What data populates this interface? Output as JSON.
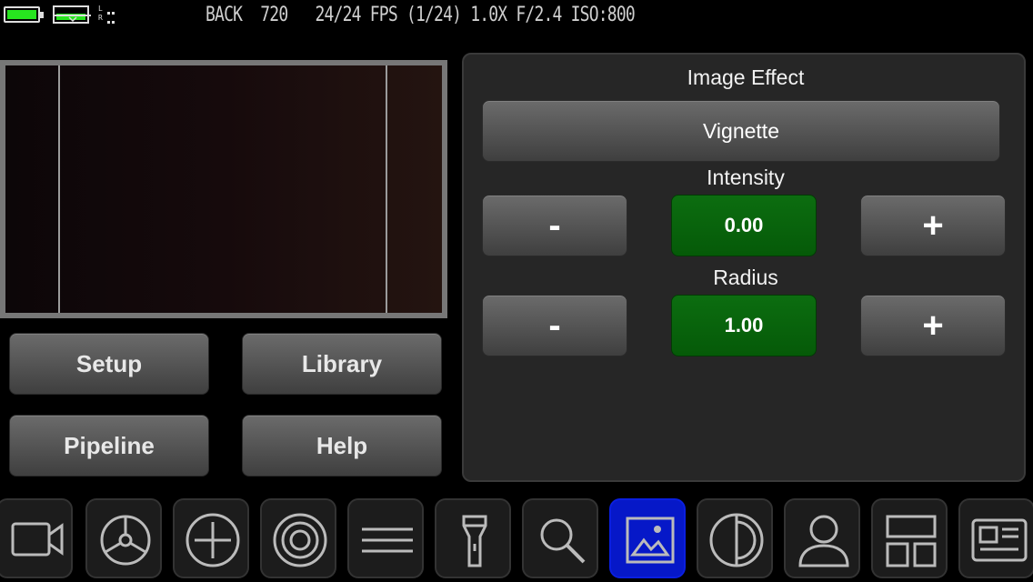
{
  "status": {
    "lr_top": "L",
    "lr_bottom": "R",
    "text": "BACK  720   24/24 FPS (1/24) 1.0X F/2.4 ISO:800"
  },
  "nav_buttons": {
    "setup": "Setup",
    "library": "Library",
    "pipeline": "Pipeline",
    "help": "Help"
  },
  "panel": {
    "title": "Image Effect",
    "effect_value": "Vignette",
    "intensity": {
      "label": "Intensity",
      "value": "0.00",
      "minus": "-",
      "plus": "+"
    },
    "radius": {
      "label": "Radius",
      "value": "1.00",
      "minus": "-",
      "plus": "+"
    }
  },
  "toolbar": {
    "tools": [
      "video-camera-icon",
      "settings-wheel-icon",
      "crosshair-icon",
      "target-icon",
      "menu-lines-icon",
      "flashlight-icon",
      "search-icon",
      "image-icon",
      "contrast-icon",
      "person-icon",
      "layout-icon",
      "news-icon"
    ],
    "active": "image-icon"
  },
  "colors": {
    "battery": "#27e51f",
    "value_green": "#0c6d10",
    "active_tool": "#0618c8"
  }
}
